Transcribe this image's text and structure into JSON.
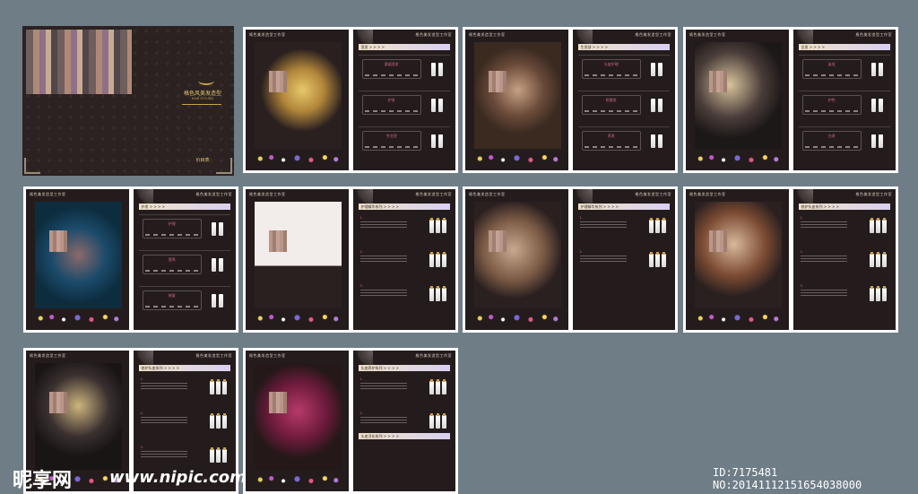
{
  "cover": {
    "title": "格色风美发造型",
    "subtitle": "HAIR STYLING",
    "price_label": "价目表"
  },
  "page_header": "格色美发造型工作室",
  "spreads": [
    {
      "section": "烫发 > > > >",
      "products": [
        "柔顺烫发",
        "护发",
        "专业烫"
      ]
    },
    {
      "section": "生发部 > > > >",
      "products": [
        "头皮护理",
        "防脱发",
        "养发"
      ]
    },
    {
      "section": "白发 > > > >",
      "products": [
        "染发",
        "护色",
        "白发"
      ]
    },
    {
      "section": "护发 > > > >",
      "products": [
        "护理",
        "营养",
        "修复"
      ]
    },
    {
      "section": "护理精华系列 > > > >",
      "products": [
        "1.",
        "2.",
        "3."
      ]
    },
    {
      "section": "护理精华系列 > > > >",
      "products": [
        "1.",
        "2."
      ]
    },
    {
      "section": "修护头皮系列 > > > >",
      "products": [
        "1.",
        "2.",
        "3."
      ]
    },
    {
      "section": "修护头皮系列 > > > >",
      "products": [
        "1.",
        "2.",
        "3."
      ]
    },
    {
      "section": "头皮养护系列 > > > >",
      "products": [
        "1.",
        "2."
      ],
      "section2": "头皮活化系列 > > > >"
    }
  ],
  "watermark": {
    "brand": "昵享网",
    "url": "www.nipic.com",
    "id": "ID:7175481 NO:20141112151654038000"
  },
  "colors": {
    "background": "#6f7d87",
    "page": "#241c1c",
    "accent_gold": "#c9a14b",
    "accent_pink": "#d36b8a"
  }
}
